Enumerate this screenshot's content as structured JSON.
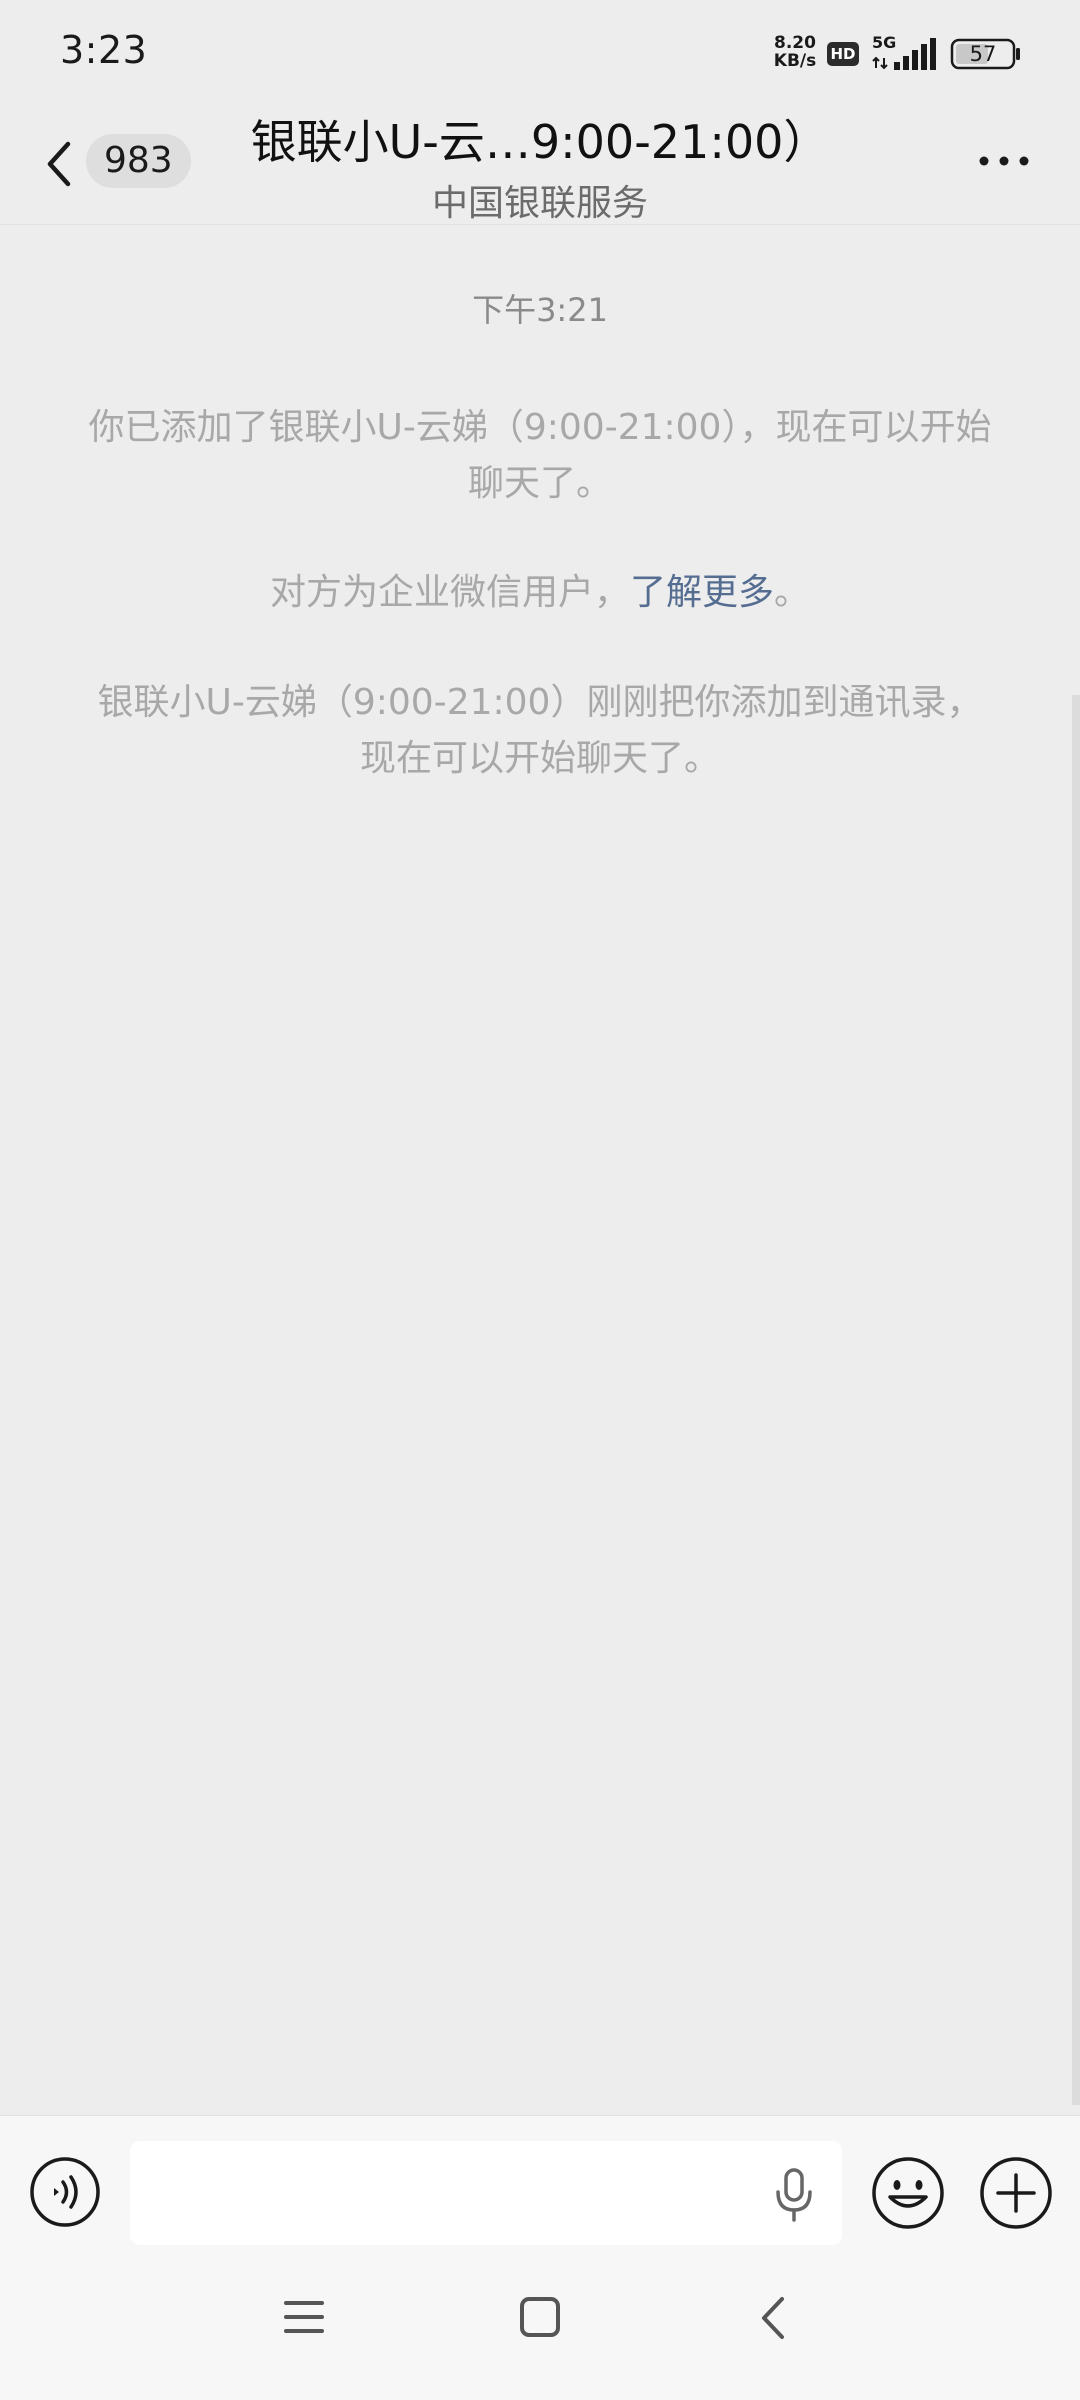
{
  "status_bar": {
    "time": "3:23",
    "net_speed_value": "8.20",
    "net_speed_unit": "KB/s",
    "hd": "HD",
    "network": "5G",
    "battery": "57"
  },
  "header": {
    "unread_count": "983",
    "title": "银联小U-云…9:00-21:00）",
    "subtitle": "中国银联服务"
  },
  "messages": {
    "timestamp": "下午3:21",
    "added_notice": "你已添加了银联小U-云娣（9:00-21:00），现在可以开始聊天了。",
    "enterprise_notice_prefix": "对方为企业微信用户，",
    "enterprise_notice_link": "了解更多",
    "enterprise_notice_suffix": "。",
    "contact_notice": "银联小U-云娣（9:00-21:00）刚刚把你添加到通讯录，现在可以开始聊天了。"
  },
  "input": {
    "value": "",
    "placeholder": ""
  },
  "icons": {
    "back": "back-chevron-icon",
    "more": "more-dots-icon",
    "voice": "voice-toggle-icon",
    "mic": "microphone-icon",
    "emoji": "emoji-icon",
    "plus": "plus-icon"
  },
  "colors": {
    "background": "#ededed",
    "link": "#566d92",
    "system_text": "#a8a8a8"
  }
}
